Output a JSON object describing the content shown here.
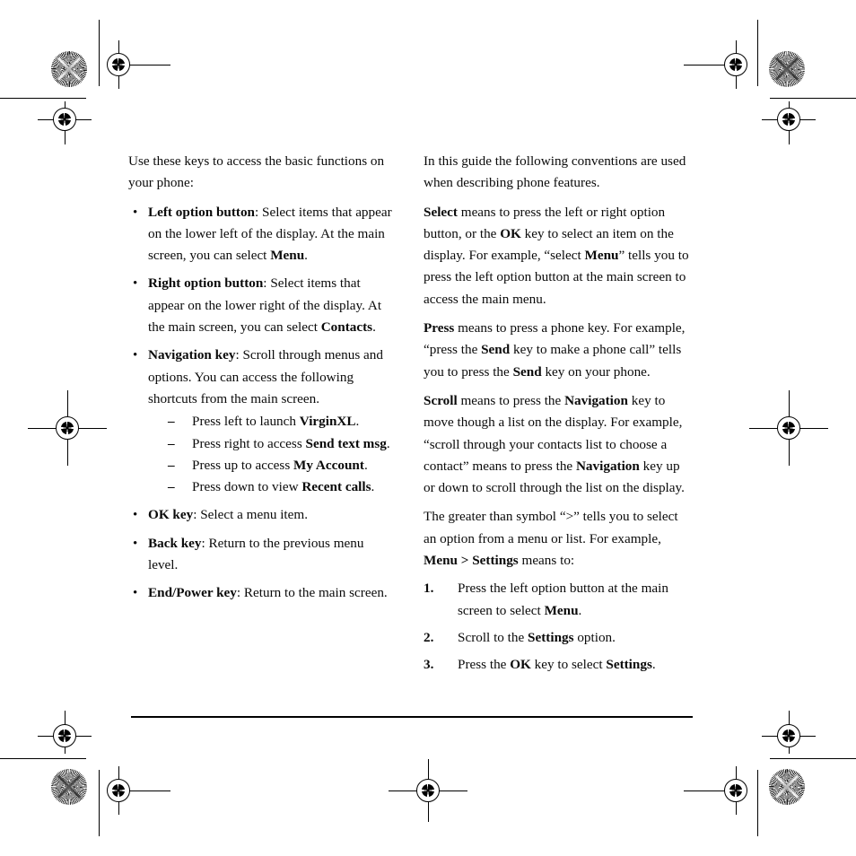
{
  "document": {
    "type": "printed-manual-page",
    "layout": "two-column",
    "colors": {
      "ink": "#000000",
      "paper": "#ffffff"
    }
  },
  "left_column": {
    "intro": "Use these keys to access the basic functions on your phone:",
    "bullets": [
      {
        "id": "left-option-button",
        "term": "Left option button",
        "text": ": Select items that appear on the lower left of the display. At the main screen, you can select ",
        "emphasis": "Menu",
        "tail": "."
      },
      {
        "id": "right-option-button",
        "term": "Right option button",
        "text": ": Select items that appear on the lower right of the display. At the main screen, you can select ",
        "emphasis": "Contacts",
        "tail": "."
      },
      {
        "id": "navigation-key",
        "term": "Navigation key",
        "text": ": Scroll through menus and options. You can access the following shortcuts from the main screen.",
        "emphasis": "",
        "tail": ""
      },
      {
        "id": "ok-key",
        "term": "OK key",
        "text": ": Select a menu item.",
        "emphasis": "",
        "tail": ""
      },
      {
        "id": "back-key",
        "term": "Back key",
        "text": ": Return to the previous menu level.",
        "emphasis": "",
        "tail": ""
      },
      {
        "id": "end-power-key",
        "term": "End/Power key",
        "text": ": Return to the main screen.",
        "emphasis": "",
        "tail": ""
      }
    ],
    "nav_shortcuts": [
      {
        "lead": "Press left to launch ",
        "emphasis": "VirginXL",
        "tail": "."
      },
      {
        "lead": "Press right to access ",
        "emphasis": "Send text msg",
        "tail": "."
      },
      {
        "lead": "Press up to access ",
        "emphasis": "My Account",
        "tail": "."
      },
      {
        "lead": "Press down to view ",
        "emphasis": "Recent calls",
        "tail": "."
      }
    ],
    "bullet_glyph": "•",
    "dash_glyph": "–"
  },
  "right_column": {
    "intro": "In this guide the following conventions are used when describing phone features.",
    "paragraphs": [
      {
        "id": "select-convention",
        "term": "Select",
        "part1": " means to press the left or right option button, or the ",
        "em1": "OK",
        "part2": " key to select an item on the display. For example, “select ",
        "em2": "Menu",
        "part3": "” tells you to press the left option button at the main screen to access the main menu."
      },
      {
        "id": "press-convention",
        "term": "Press",
        "part1": " means to press a phone key. For example, “press the ",
        "em1": "Send",
        "part2": " key to make a phone call” tells you to press the ",
        "em2": "Send",
        "part3": " key on your phone."
      },
      {
        "id": "scroll-convention",
        "term": "Scroll",
        "part1": " means to press the ",
        "em1": "Navigation",
        "part2": " key to move though a list on the display. For example, “scroll through your contacts list to choose a contact” means to press the ",
        "em2": "Navigation",
        "part3": " key up or down to scroll through the list on the display."
      }
    ],
    "greater_than": {
      "lead": "The greater than symbol “>” tells you to select an option from a menu or list. For example, ",
      "em1": "Menu >",
      "mid": " ",
      "em2": "Settings",
      "tail": " means to:"
    },
    "steps": [
      {
        "num": "1.",
        "lead": "Press the left option button at the main screen to select ",
        "emphasis": "Menu",
        "tail": "."
      },
      {
        "num": "2.",
        "lead": " Scroll to the ",
        "emphasis": "Settings",
        "tail": " option."
      },
      {
        "num": "3.",
        "lead": " Press the ",
        "emphasis": "OK",
        "mid": " key to select ",
        "emphasis2": "Settings",
        "tail": "."
      }
    ]
  },
  "print_marks": {
    "description": "Offset-press registration and trim marks around the page edges",
    "targets": "registration-crosshair-target",
    "stars": "registration-star-rosette"
  }
}
